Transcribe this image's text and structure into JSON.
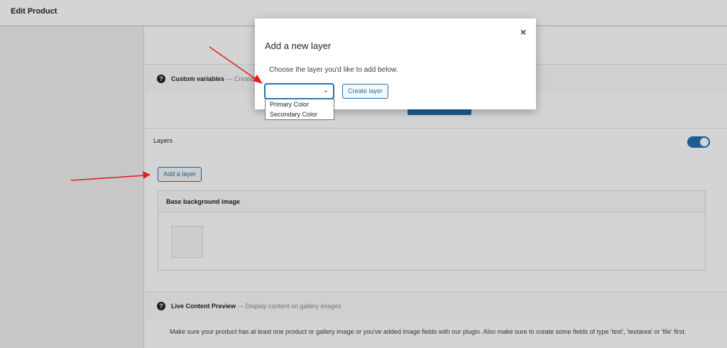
{
  "header": {
    "title": "Edit Product"
  },
  "sections": {
    "custom_variables": {
      "title": "Custom variables",
      "separator": " — ",
      "subtitle": "Create"
    },
    "layers": {
      "title": "Layers"
    },
    "add_layer_button": "Add a layer",
    "base_layer": {
      "title": "Base background image"
    },
    "live_preview": {
      "title": "Live Content Preview",
      "separator": " — ",
      "subtitle": "Display content on gallery images"
    },
    "note": "Make sure your product has at least one product or gallery image or you've added image fields with our plugin. Also make sure to create some fields of type 'text', 'textarea' or 'file' first."
  },
  "modal": {
    "title": "Add a new layer",
    "close_label": "×",
    "description": "Choose the layer you'd like to add below.",
    "select_value": "",
    "create_button": "Create layer",
    "options": [
      "Primary Color",
      "Secondary Color"
    ]
  },
  "icons": {
    "help": "?",
    "chevron": "⌄"
  },
  "colors": {
    "accent": "#2271b1",
    "annotation_arrow": "#e02020"
  }
}
